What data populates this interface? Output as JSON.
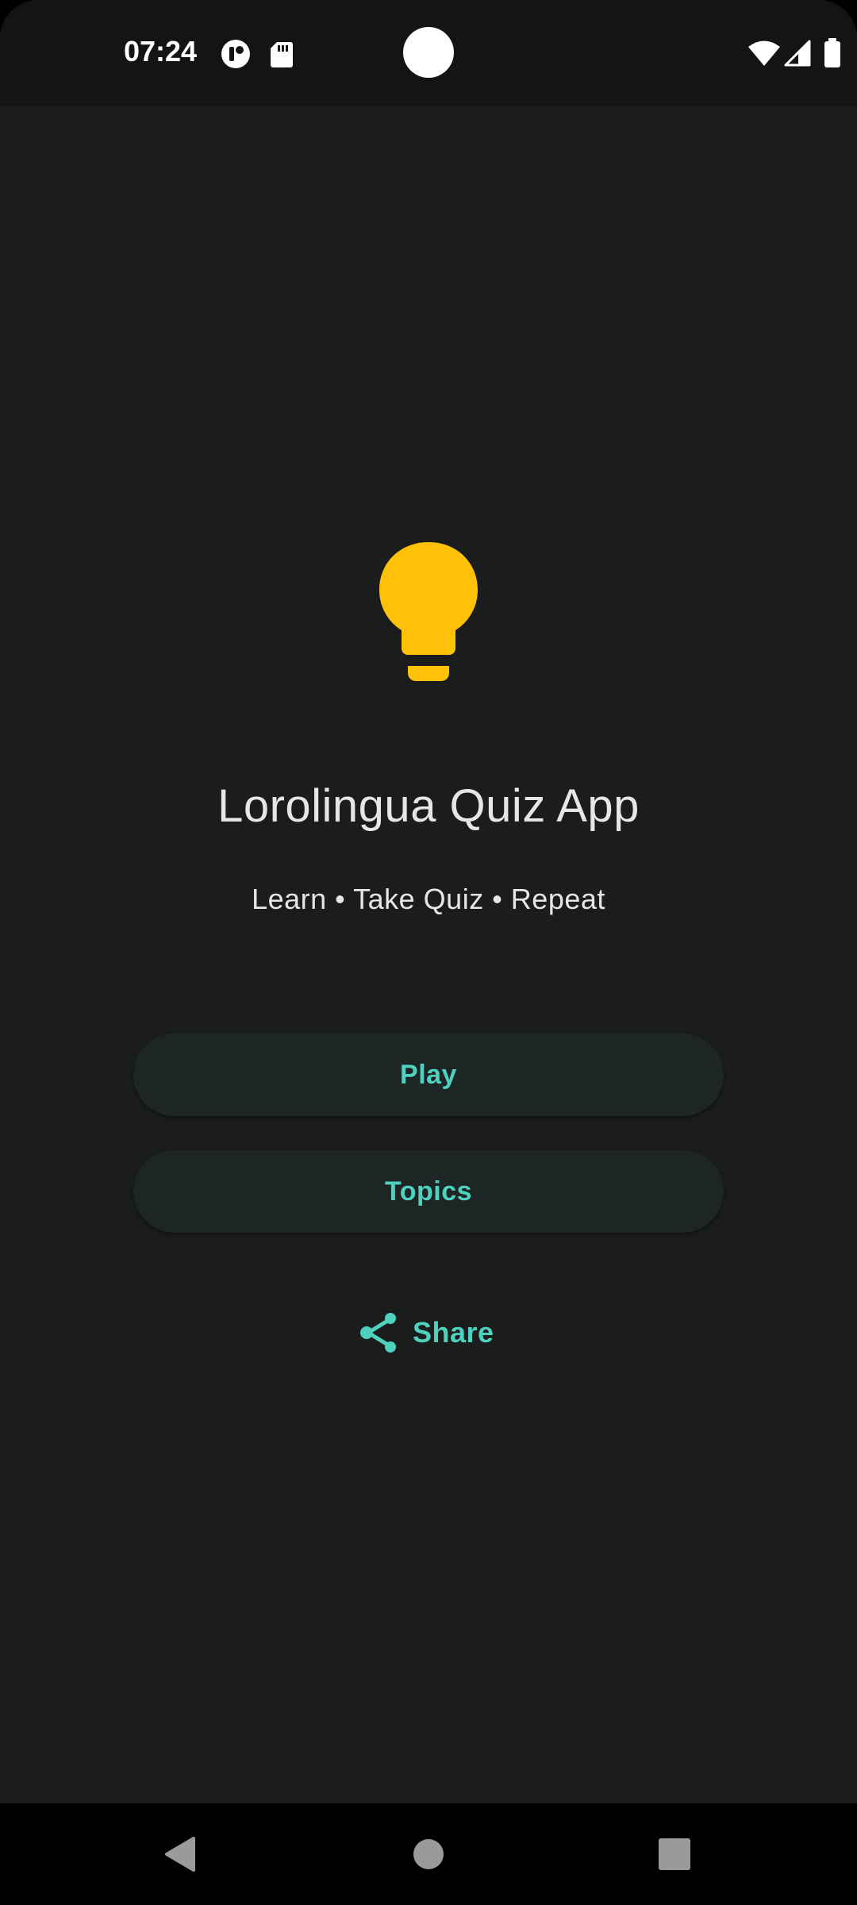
{
  "status_bar": {
    "time": "07:24",
    "left_icons": [
      "cast-record-icon",
      "sd-card-icon"
    ],
    "right_icons": [
      "wifi-icon",
      "cellular-signal-icon",
      "battery-icon"
    ]
  },
  "main": {
    "logo_icon": "lightbulb-icon",
    "title": "Lorolingua Quiz App",
    "tagline": "Learn • Take Quiz • Repeat",
    "buttons": {
      "play_label": "Play",
      "topics_label": "Topics",
      "share_label": "Share"
    }
  },
  "nav_bar": {
    "items": [
      "back-icon",
      "home-icon",
      "recents-icon"
    ]
  },
  "colors": {
    "background": "#1b1c1c",
    "status_bar": "#131414",
    "accent": "#4fd1c0",
    "bulb": "#ffc107",
    "button_bg": "#1e2525",
    "text": "#e6e6e6"
  }
}
